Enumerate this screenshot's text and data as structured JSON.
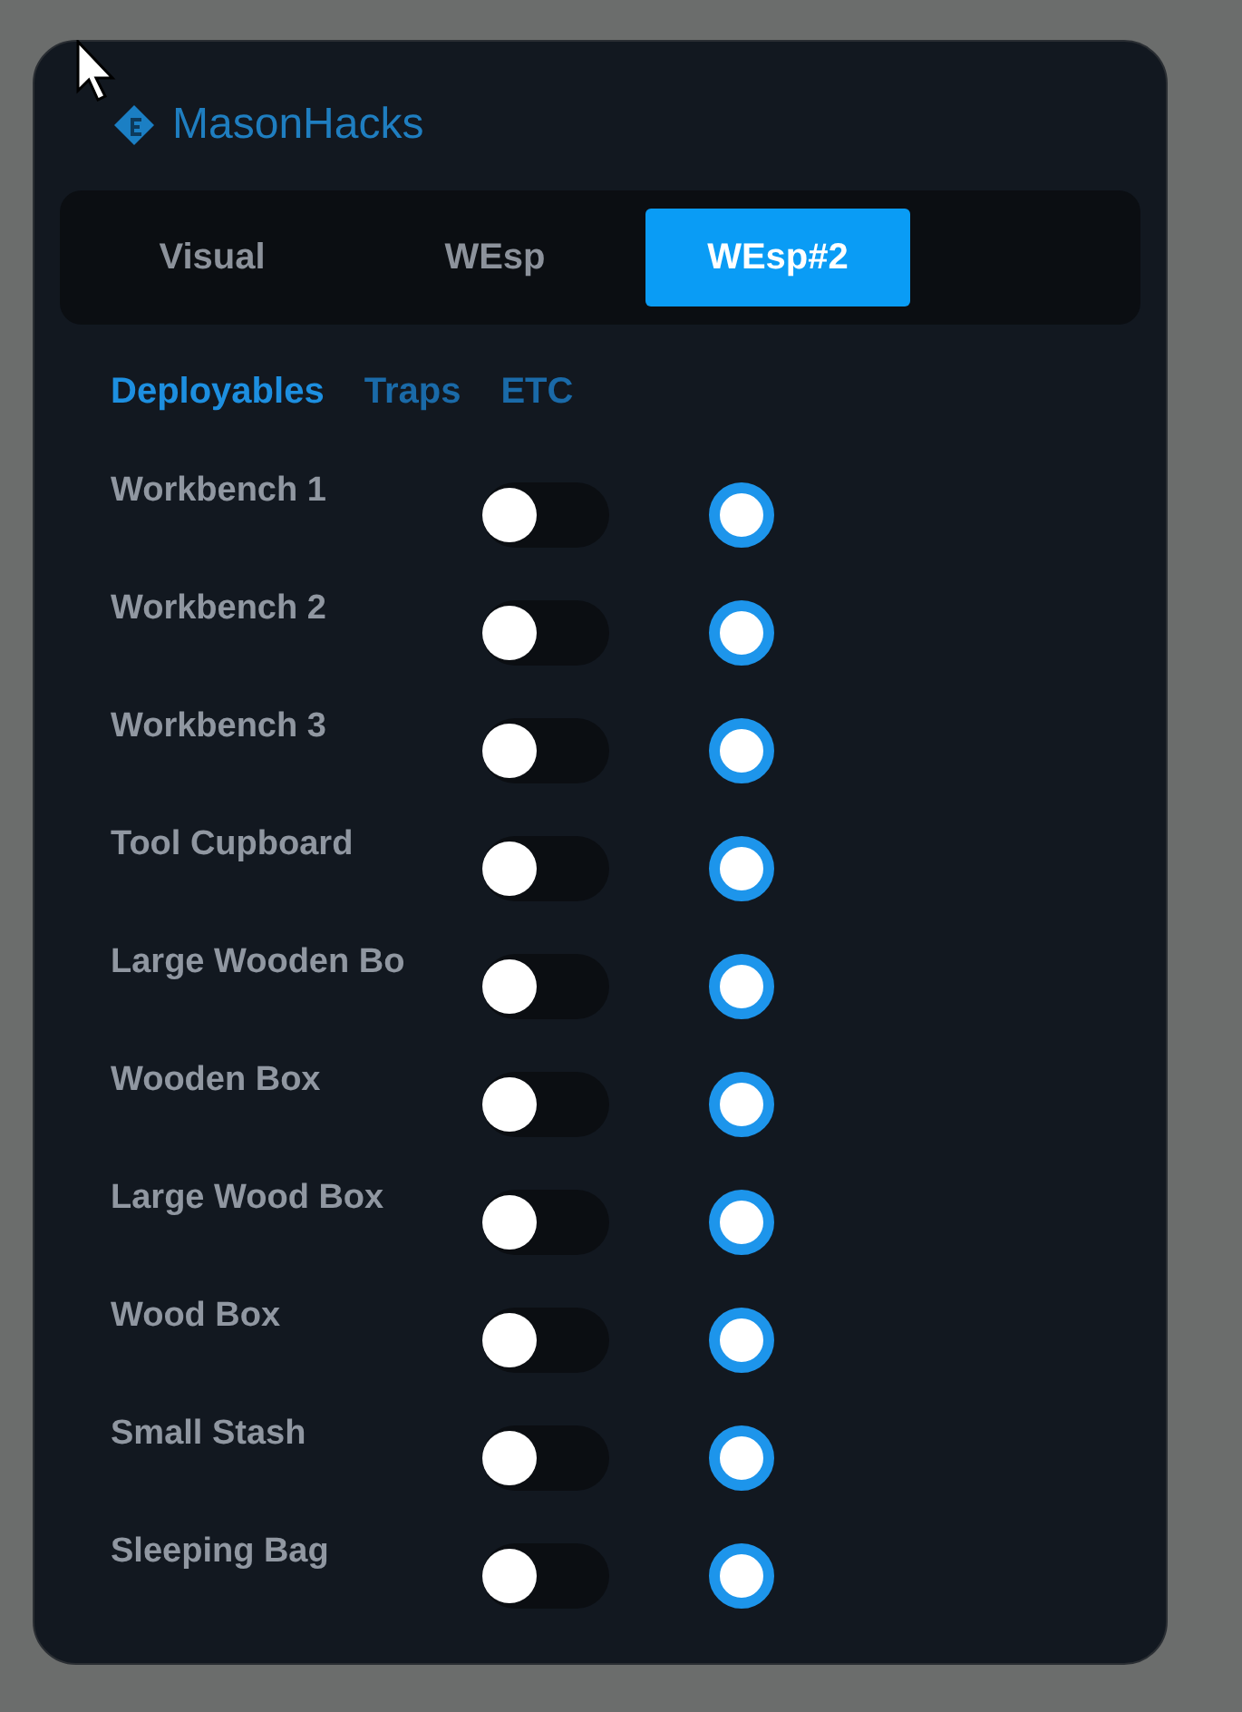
{
  "window": {
    "title": "MasonHacks"
  },
  "tabs": [
    {
      "label": "Visual",
      "selected": false
    },
    {
      "label": "WEsp",
      "selected": false
    },
    {
      "label": "WEsp#2",
      "selected": true
    }
  ],
  "subtabs": [
    {
      "label": "Deployables",
      "selected": true
    },
    {
      "label": "Traps",
      "selected": false
    },
    {
      "label": "ETC",
      "selected": false
    }
  ],
  "items": [
    {
      "name": "Workbench 1",
      "on": false
    },
    {
      "name": "Workbench 2",
      "on": false
    },
    {
      "name": "Workbench 3",
      "on": false
    },
    {
      "name": "Tool Cupboard",
      "on": false
    },
    {
      "name": "Large Wooden Bo",
      "on": false
    },
    {
      "name": "Wooden Box",
      "on": false
    },
    {
      "name": "Large Wood Box",
      "on": false
    },
    {
      "name": "Wood Box",
      "on": false
    },
    {
      "name": "Small Stash",
      "on": false
    },
    {
      "name": "Sleeping Bag",
      "on": false
    }
  ]
}
